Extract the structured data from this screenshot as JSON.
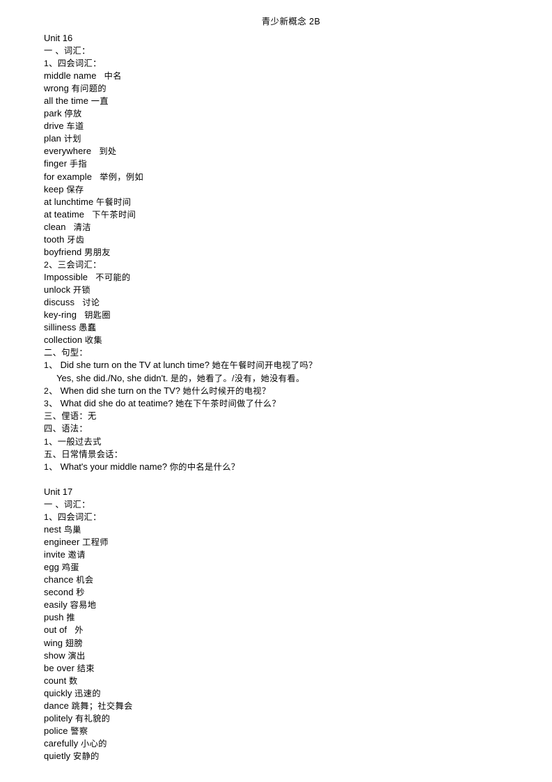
{
  "document": {
    "header_title": "青少新概念 2B"
  },
  "units": [
    {
      "title": "Unit 16",
      "sections": [
        {
          "type": "heading",
          "text": "一 、词汇："
        },
        {
          "type": "subheading",
          "text": "1、四会词汇："
        },
        {
          "type": "vocab",
          "items": [
            {
              "en": "middle name",
              "cn": "中名",
              "gap": "wide"
            },
            {
              "en": "wrong",
              "cn": "有问题的",
              "gap": "normal"
            },
            {
              "en": "all the time",
              "cn": "一直",
              "gap": "normal"
            },
            {
              "en": "park",
              "cn": "停放",
              "gap": "normal"
            },
            {
              "en": "drive",
              "cn": "车道",
              "gap": "normal"
            },
            {
              "en": "plan",
              "cn": "计划",
              "gap": "normal"
            },
            {
              "en": "everywhere",
              "cn": "到处",
              "gap": "wide"
            },
            {
              "en": "finger",
              "cn": "手指",
              "gap": "normal"
            },
            {
              "en": "for example",
              "cn": "举例，例如",
              "gap": "wide"
            },
            {
              "en": "keep",
              "cn": "保存",
              "gap": "normal"
            },
            {
              "en": "at lunchtime",
              "cn": "午餐时间",
              "gap": "normal"
            },
            {
              "en": "at teatime",
              "cn": "下午茶时间",
              "gap": "wide"
            },
            {
              "en": "clean",
              "cn": "清洁",
              "gap": "wide"
            },
            {
              "en": "tooth",
              "cn": "牙齿",
              "gap": "normal"
            },
            {
              "en": "boyfriend",
              "cn": "男朋友",
              "gap": "normal"
            }
          ]
        },
        {
          "type": "subheading",
          "text": "2、三会词汇："
        },
        {
          "type": "vocab",
          "items": [
            {
              "en": "Impossible",
              "cn": "不可能的",
              "gap": "wide"
            },
            {
              "en": "unlock",
              "cn": "开锁",
              "gap": "normal"
            },
            {
              "en": "discuss",
              "cn": "讨论",
              "gap": "wide"
            },
            {
              "en": "key-ring",
              "cn": "钥匙圈",
              "gap": "wide"
            },
            {
              "en": "silliness",
              "cn": "愚蠢",
              "gap": "normal"
            },
            {
              "en": "collection",
              "cn": "收集",
              "gap": "normal"
            }
          ]
        },
        {
          "type": "heading",
          "text": "二、句型："
        },
        {
          "type": "sentences",
          "items": [
            {
              "num": "1、",
              "en": "Did she turn on the TV at lunch time?",
              "cn": "她在午餐时间开电视了吗？",
              "cont_en": "Yes, she did./No, she didn't.",
              "cont_cn": "是的，她看了。/没有，她没有看。"
            },
            {
              "num": "2、",
              "en": "When did she turn on the TV?",
              "cn": "她什么时候开的电视？"
            },
            {
              "num": "3、",
              "en": "What did she do at teatime?",
              "cn": "她在下午茶时间做了什么？"
            }
          ]
        },
        {
          "type": "heading",
          "text": "三、俚语：无"
        },
        {
          "type": "heading",
          "text": "四、语法："
        },
        {
          "type": "subheading",
          "text": "1、一般过去式"
        },
        {
          "type": "heading",
          "text": "五、日常情景会话："
        },
        {
          "type": "sentences",
          "items": [
            {
              "num": "1、",
              "en": "What's your middle name?",
              "cn": "你的中名是什么？"
            }
          ]
        }
      ]
    },
    {
      "title": "Unit 17",
      "sections": [
        {
          "type": "heading",
          "text": "一 、词汇："
        },
        {
          "type": "subheading",
          "text": "1、四会词汇："
        },
        {
          "type": "vocab",
          "items": [
            {
              "en": "nest",
              "cn": "鸟巢",
              "gap": "normal"
            },
            {
              "en": "engineer",
              "cn": "工程师",
              "gap": "normal"
            },
            {
              "en": "invite",
              "cn": "邀请",
              "gap": "normal"
            },
            {
              "en": "egg",
              "cn": "鸡蛋",
              "gap": "normal"
            },
            {
              "en": "chance",
              "cn": "机会",
              "gap": "normal"
            },
            {
              "en": "second",
              "cn": "秒",
              "gap": "normal"
            },
            {
              "en": "easily",
              "cn": "容易地",
              "gap": "normal"
            },
            {
              "en": "push",
              "cn": "推",
              "gap": "normal"
            },
            {
              "en": "out of",
              "cn": "外",
              "gap": "wide"
            },
            {
              "en": "wing",
              "cn": "翅膀",
              "gap": "normal"
            },
            {
              "en": "show",
              "cn": "演出",
              "gap": "normal"
            },
            {
              "en": "be over",
              "cn": "结束",
              "gap": "normal"
            },
            {
              "en": "count",
              "cn": "数",
              "gap": "normal"
            },
            {
              "en": "quickly",
              "cn": "迅速的",
              "gap": "normal"
            },
            {
              "en": "dance",
              "cn": "跳舞；社交舞会",
              "gap": "normal"
            },
            {
              "en": "politely",
              "cn": "有礼貌的",
              "gap": "normal"
            },
            {
              "en": "police",
              "cn": "警察",
              "gap": "normal"
            },
            {
              "en": "carefully",
              "cn": "小心的",
              "gap": "normal"
            },
            {
              "en": "quietly",
              "cn": "安静的",
              "gap": "normal"
            }
          ]
        }
      ]
    }
  ]
}
